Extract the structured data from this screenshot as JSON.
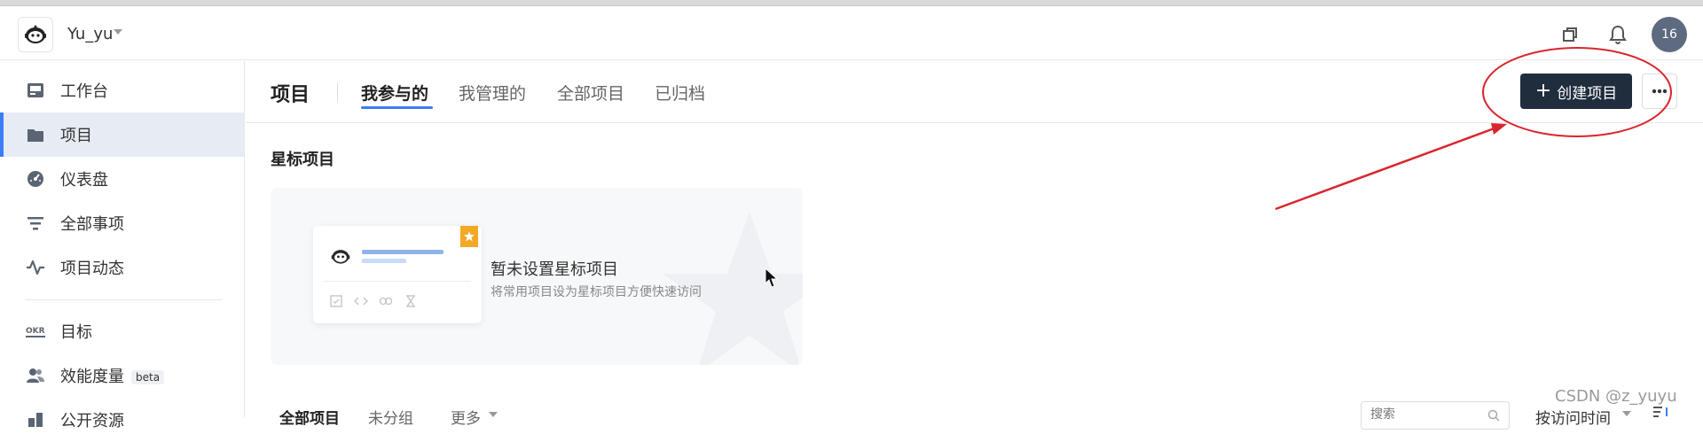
{
  "topbar": {
    "username": "Yu_yu",
    "avatar_count": "16"
  },
  "sidebar": {
    "items": [
      {
        "label": "工作台",
        "icon": "workbench-icon"
      },
      {
        "label": "项目",
        "icon": "folder-icon"
      },
      {
        "label": "仪表盘",
        "icon": "dashboard-icon"
      },
      {
        "label": "全部事项",
        "icon": "filter-icon"
      },
      {
        "label": "项目动态",
        "icon": "activity-icon"
      },
      {
        "label": "目标",
        "icon": "okr-icon"
      },
      {
        "label": "效能度量",
        "icon": "people-icon",
        "badge": "beta"
      },
      {
        "label": "公开资源",
        "icon": "resource-icon"
      }
    ],
    "okr_icon_text": "OKR"
  },
  "header": {
    "title": "项目",
    "tabs": [
      "我参与的",
      "我管理的",
      "全部项目",
      "已归档"
    ],
    "create_label": "创建项目"
  },
  "starred": {
    "section_title": "星标项目",
    "empty_title": "暂未设置星标项目",
    "empty_desc": "将常用项目设为星标项目方便快速访问"
  },
  "list": {
    "tabs": [
      "全部项目",
      "未分组",
      "更多"
    ],
    "search_placeholder": "搜索",
    "sort_label": "按访问时间"
  },
  "watermark": "CSDN @z_yuyu",
  "colors": {
    "accent": "#3d7cf7",
    "primary_button": "#1f2d3d",
    "annotation_red": "#d9262e"
  }
}
